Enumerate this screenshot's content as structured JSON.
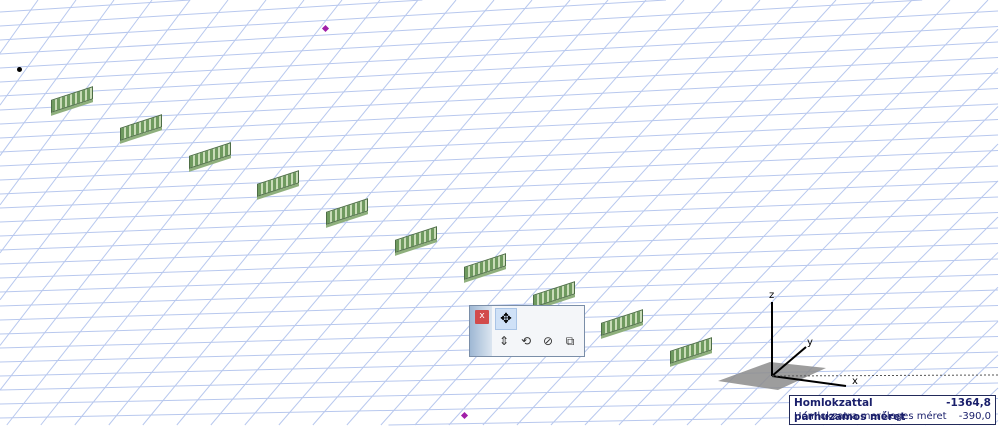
{
  "axes": {
    "x": "x",
    "y": "y",
    "z": "z"
  },
  "palette": {
    "close_label": "x",
    "move_icon": "move-icon",
    "tools": [
      "elevate-icon",
      "rotate-icon",
      "mirror-icon",
      "multiply-icon"
    ]
  },
  "info": {
    "row1_label": "Homlokzattal párhuzamos méret",
    "row1_value": "-1364,8",
    "row2_label": "Homlokzatra merőleges méret",
    "row2_value": "-390,0"
  },
  "colors": {
    "grid": "#b8c8ee",
    "marker": "#a01fa8",
    "block": "#6f9a5f"
  },
  "block_count": 10
}
